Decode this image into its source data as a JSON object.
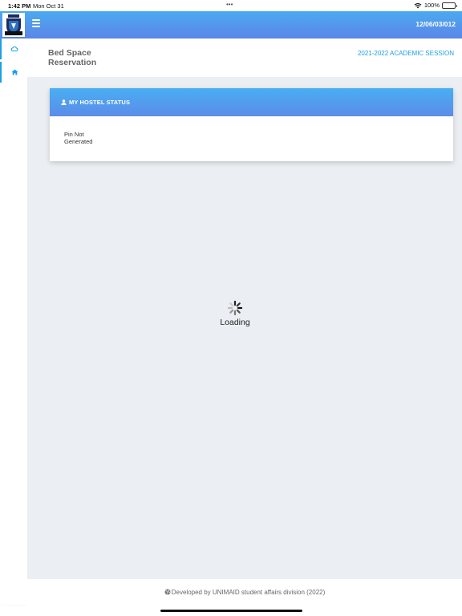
{
  "status_bar": {
    "time": "1:42 PM",
    "date": "Mon Oct 31",
    "battery": "100%",
    "icons": [
      "wifi-icon",
      "battery-icon"
    ]
  },
  "header": {
    "logo": "university-logo",
    "menu_icon": "hamburger-icon",
    "code": "12/06/03/012",
    "gradient": [
      "#4aaaf0",
      "#5b86e8"
    ]
  },
  "sidebar": {
    "items": [
      {
        "icon": "cloud-icon",
        "active": false
      },
      {
        "icon": "home-icon",
        "active": true
      }
    ],
    "accent": "#1ca0e3"
  },
  "page": {
    "title": "Bed Space Reservation",
    "session": "2021-2022 ACADEMIC SESSION"
  },
  "hostel_card": {
    "title": "MY HOSTEL STATUS",
    "icon": "user-icon",
    "status": "Pin Not Generated"
  },
  "loading": {
    "text": "Loading",
    "icon": "spinner-icon"
  },
  "footer": {
    "icon": "globe-icon",
    "text": "Developed by UNIMAID student affairs division (2022)"
  }
}
